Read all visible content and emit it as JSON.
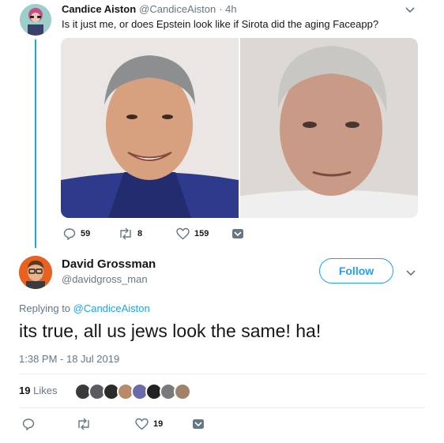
{
  "quoted_tweet": {
    "author_name": "Candice Aiston",
    "author_handle": "@CandiceAiston",
    "time": "· 4h",
    "text": "Is it just me, or does Epstein look like if Sirota did the aging Faceapp?",
    "actions": {
      "replies": "59",
      "retweets": "8",
      "likes": "159"
    }
  },
  "main_tweet": {
    "author_name": "David Grossman",
    "author_handle": "@davidgross_man",
    "follow_label": "Follow",
    "replying_prefix": "Replying to",
    "replying_to": "@CandiceAiston",
    "text": "its true, all us jews look the same! ha!",
    "timestamp": "1:38 PM - 18 Jul 2019",
    "likes_count": "19",
    "likes_label": "Likes",
    "actions": {
      "likes": "19"
    }
  },
  "colors": {
    "accent": "#1da1f2",
    "muted": "#657786",
    "text": "#14171a",
    "divider": "#e6ecf0"
  },
  "icons": [
    "chevron-down-icon",
    "reply-icon",
    "retweet-icon",
    "heart-icon",
    "dm-icon"
  ]
}
